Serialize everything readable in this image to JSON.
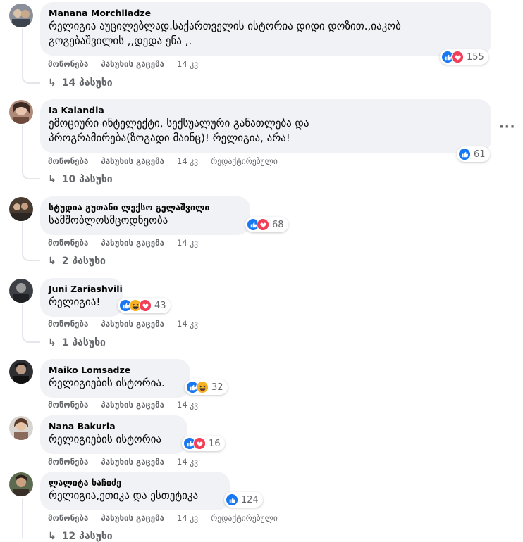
{
  "colors": {
    "like": "#1877f2",
    "love": "#f33e58",
    "haha": "#f7b125",
    "bubble": "#f0f2f5",
    "meta": "#65676b"
  },
  "comments": [
    {
      "author": "Manana Morchiladze",
      "lines": [
        "რელიგია აუცილებლად.საქართველის ისტორია დიდი დოზით.,იაკობ",
        "გოგებაშვილის ,,დედა ენა ,."
      ],
      "reactions": [
        "like",
        "love"
      ],
      "count": "155",
      "like": "მოწონება",
      "reply": "პასუხის გაცემა",
      "time": "14 კვ",
      "edited": "",
      "replies": "14 პასუხი"
    },
    {
      "author": "Ia Kalandia",
      "lines": [
        "ემოციური ინტელექტი, სექსუალური განათლება და",
        "პროგრამირება(ზოგადი მაინც)! რელიგია, არა!"
      ],
      "reactions": [
        "like"
      ],
      "count": "61",
      "like": "მოწონება",
      "reply": "პასუხის გაცემა",
      "time": "14 კვ",
      "edited": "რედაქტირებული",
      "replies": "10 პასუხი"
    },
    {
      "author": "სტუდია გუთანი ლექსო გელაშვილი",
      "lines": [
        "სამშობლოსმცოდნეობა"
      ],
      "reactions": [
        "like",
        "love"
      ],
      "count": "68",
      "like": "მოწონება",
      "reply": "პასუხის გაცემა",
      "time": "14 კვ",
      "edited": "",
      "replies": "2 პასუხი"
    },
    {
      "author": "Juni Zariashvili",
      "lines": [
        "რელიგია!"
      ],
      "reactions": [
        "like",
        "haha",
        "love"
      ],
      "count": "43",
      "like": "მოწონება",
      "reply": "პასუხის გაცემა",
      "time": "14 კვ",
      "edited": "",
      "replies": "1 პასუხი"
    },
    {
      "author": "Maiko Lomsadze",
      "lines": [
        "რელიგიების ისტორია."
      ],
      "reactions": [
        "like",
        "haha"
      ],
      "count": "32",
      "like": "მოწონება",
      "reply": "პასუხის გაცემა",
      "time": "14 კვ",
      "edited": "",
      "replies": ""
    },
    {
      "author": "Nana Bakuria",
      "lines": [
        "რელიგიების ისტორია"
      ],
      "reactions": [
        "like",
        "love"
      ],
      "count": "16",
      "like": "მოწონება",
      "reply": "პასუხის გაცემა",
      "time": "14 კვ",
      "edited": "",
      "replies": ""
    },
    {
      "author": "ლალიტა ხაჩიძე",
      "lines": [
        "რელიგია,ეთიკა და ესთეტიკა"
      ],
      "reactions": [
        "like"
      ],
      "count": "124",
      "like": "მოწონება",
      "reply": "პასუხის გაცემა",
      "time": "14 კვ",
      "edited": "რედაქტირებული",
      "replies": "12 პასუხი"
    }
  ],
  "more_icon": "more-options-icon",
  "more_label": "···"
}
